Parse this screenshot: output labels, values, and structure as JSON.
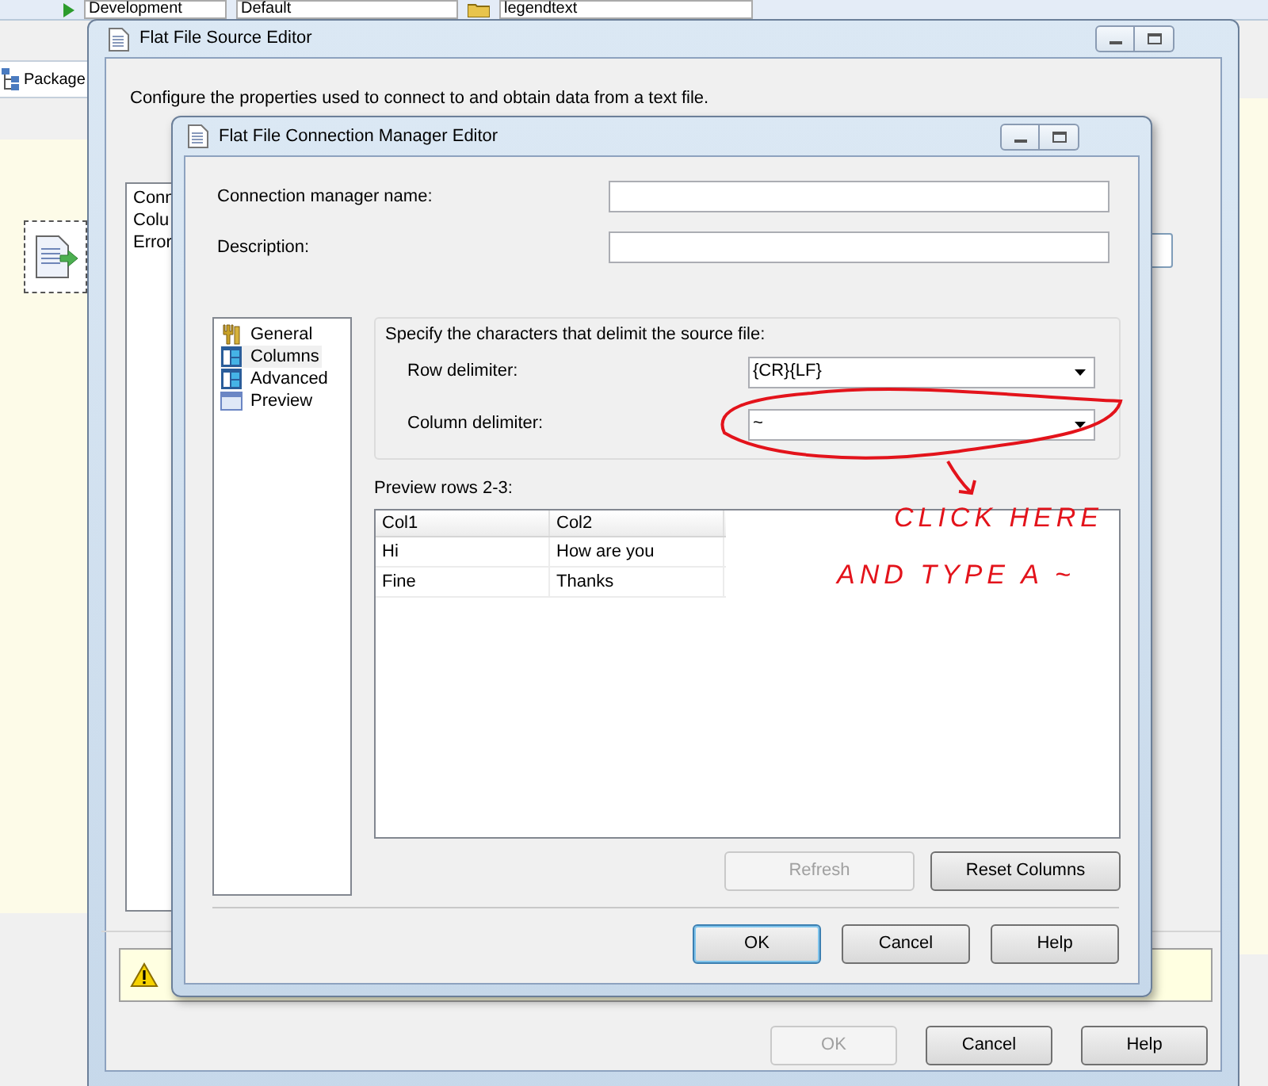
{
  "ide": {
    "toolbar": {
      "configuration": "Development",
      "platform": "Default",
      "project": "legendtext"
    },
    "package_tab": "Package"
  },
  "outer_dialog": {
    "title": "Flat File Source Editor",
    "description": "Configure the properties used to connect to and obtain data from a text file.",
    "nav_items": [
      "Conn",
      "Colu",
      "Error"
    ],
    "buttons": [
      {
        "label": "OK",
        "disabled": true,
        "default": false
      },
      {
        "label": "Cancel",
        "disabled": false,
        "default": false
      },
      {
        "label": "Help",
        "disabled": false,
        "default": false
      }
    ]
  },
  "inner_dialog": {
    "title": "Flat File Connection Manager Editor",
    "fields": [
      {
        "label": "Connection manager name:"
      },
      {
        "label": "Description:"
      }
    ],
    "nav_items": [
      {
        "label": "General",
        "kind": "general",
        "selected": false
      },
      {
        "label": "Columns",
        "kind": "columns",
        "selected": true
      },
      {
        "label": "Advanced",
        "kind": "columns",
        "selected": false
      },
      {
        "label": "Preview",
        "kind": "preview",
        "selected": false
      }
    ],
    "group_heading": "Specify the characters that delimit the source file:",
    "delimiters": [
      {
        "label": "Row delimiter:",
        "value": "{CR}{LF}"
      },
      {
        "label": "Column delimiter:",
        "value": "~"
      }
    ],
    "preview_label": "Preview rows 2-3:",
    "preview": {
      "columns": [
        "Col1",
        "Col2"
      ],
      "rows": [
        [
          "Hi",
          "How are you"
        ],
        [
          "Fine",
          "Thanks"
        ]
      ]
    },
    "grid_buttons": [
      {
        "label": "Refresh",
        "disabled": true,
        "default": false
      },
      {
        "label": "Reset Columns",
        "disabled": false,
        "default": false
      }
    ],
    "buttons": [
      {
        "label": "OK",
        "disabled": false,
        "default": true
      },
      {
        "label": "Cancel",
        "disabled": false,
        "default": false
      },
      {
        "label": "Help",
        "disabled": false,
        "default": false
      }
    ]
  },
  "annotation": {
    "lines": [
      "CLICK HERE",
      "AND TYPE A ~"
    ]
  }
}
